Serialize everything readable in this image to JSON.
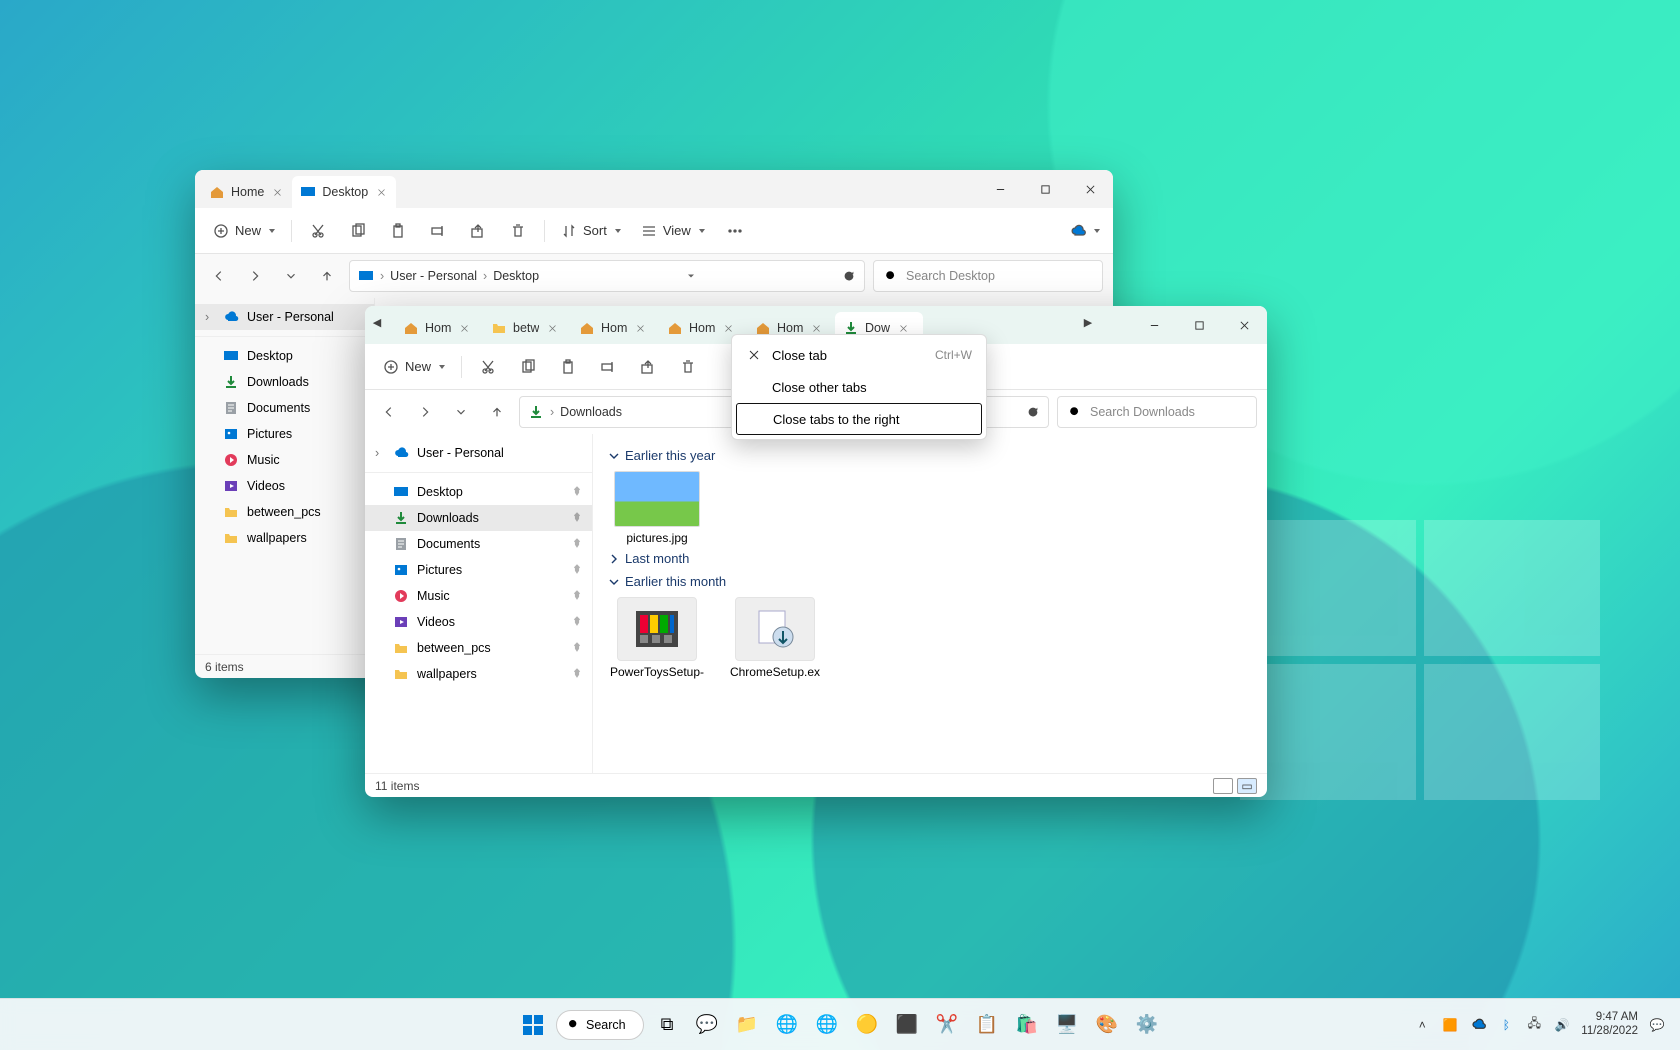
{
  "winA": {
    "tabs": [
      {
        "label": "Home",
        "active": false,
        "icon": "home"
      },
      {
        "label": "Desktop",
        "active": true,
        "icon": "desktop"
      }
    ],
    "newLabel": "New",
    "sortLabel": "Sort",
    "viewLabel": "View",
    "breadcrumb": [
      "User - Personal",
      "Desktop"
    ],
    "searchPlaceholder": "Search Desktop",
    "navExpanded": "User - Personal",
    "nav": [
      {
        "label": "Desktop",
        "icon": "desktop"
      },
      {
        "label": "Downloads",
        "icon": "download"
      },
      {
        "label": "Documents",
        "icon": "document"
      },
      {
        "label": "Pictures",
        "icon": "pictures"
      },
      {
        "label": "Music",
        "icon": "music"
      },
      {
        "label": "Videos",
        "icon": "videos"
      },
      {
        "label": "between_pcs",
        "icon": "folder"
      },
      {
        "label": "wallpapers",
        "icon": "folder"
      }
    ],
    "status": "6 items"
  },
  "winB": {
    "tabs": [
      {
        "label": "Hom",
        "icon": "home"
      },
      {
        "label": "betw",
        "icon": "folder"
      },
      {
        "label": "Hom",
        "icon": "home"
      },
      {
        "label": "Hom",
        "icon": "home"
      },
      {
        "label": "Hom",
        "icon": "home"
      },
      {
        "label": "Dow",
        "icon": "download",
        "active": true
      }
    ],
    "newLabel": "New",
    "breadcrumb": [
      "Downloads"
    ],
    "searchPlaceholder": "Search Downloads",
    "navExpanded": "User - Personal",
    "nav": [
      {
        "label": "Desktop",
        "icon": "desktop",
        "pin": true
      },
      {
        "label": "Downloads",
        "icon": "download",
        "pin": true,
        "selected": true
      },
      {
        "label": "Documents",
        "icon": "document",
        "pin": true
      },
      {
        "label": "Pictures",
        "icon": "pictures",
        "pin": true
      },
      {
        "label": "Music",
        "icon": "music",
        "pin": true
      },
      {
        "label": "Videos",
        "icon": "videos",
        "pin": true
      },
      {
        "label": "between_pcs",
        "icon": "folder",
        "pin": true
      },
      {
        "label": "wallpapers",
        "icon": "folder",
        "pin": true
      }
    ],
    "groups": [
      {
        "title": "Earlier this year",
        "expanded": true,
        "files": [
          {
            "name": "pictures.jpg",
            "thumb": "bliss"
          }
        ]
      },
      {
        "title": "Last month",
        "expanded": false,
        "files": []
      },
      {
        "title": "Earlier this month",
        "expanded": true,
        "files": [
          {
            "name": "PowerToysSetup-",
            "thumb": "powertoys"
          },
          {
            "name": "ChromeSetup.ex",
            "thumb": "installer"
          }
        ]
      }
    ],
    "status": "11 items"
  },
  "contextMenu": {
    "items": [
      {
        "label": "Close tab",
        "shortcut": "Ctrl+W",
        "icon": true
      },
      {
        "label": "Close other tabs"
      },
      {
        "label": "Close tabs to the right",
        "highlight": true
      }
    ]
  },
  "taskbar": {
    "searchLabel": "Search",
    "time": "9:47 AM",
    "date": "11/28/2022"
  }
}
